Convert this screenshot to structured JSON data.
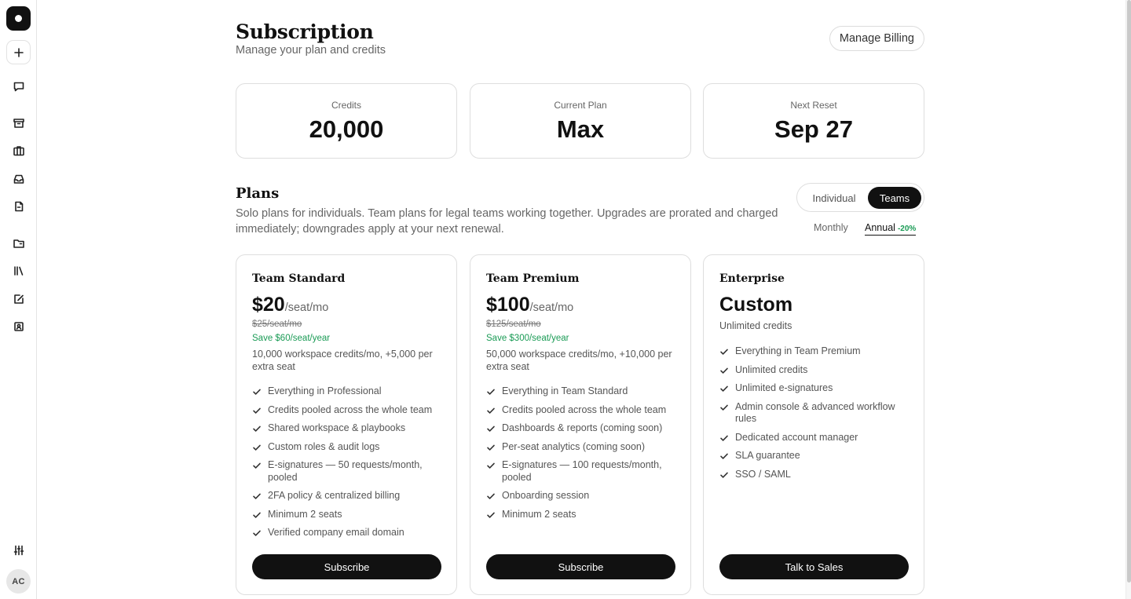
{
  "sidebar": {
    "avatar_initials": "AC",
    "icons": [
      "logo-icon",
      "plus-icon",
      "chat-icon",
      "archive-icon",
      "briefcase-icon",
      "inbox-icon",
      "documents-icon",
      "folder-icon",
      "library-icon",
      "edit-icon",
      "contact-icon",
      "settings-sliders-icon"
    ]
  },
  "header": {
    "title": "Subscription",
    "subtitle": "Manage your plan and credits",
    "manage_billing_label": "Manage Billing"
  },
  "stats": [
    {
      "label": "Credits",
      "value": "20,000"
    },
    {
      "label": "Current Plan",
      "value": "Max"
    },
    {
      "label": "Next Reset",
      "value": "Sep 27"
    }
  ],
  "plans": {
    "title": "Plans",
    "description": "Solo plans for individuals. Team plans for legal teams working together. Upgrades are prorated and charged immediately; downgrades apply at your next renewal.",
    "segment": {
      "individual_label": "Individual",
      "teams_label": "Teams",
      "selected": "Teams"
    },
    "billing": {
      "monthly_label": "Monthly",
      "annual_label": "Annual",
      "annual_discount": "-20%",
      "selected": "Annual"
    },
    "cards": [
      {
        "name": "Team Standard",
        "price": "$20",
        "per": "/seat/mo",
        "old_price": "$25/seat/mo",
        "save": "Save $60/seat/year",
        "credits": "10,000 workspace credits/mo, +5,000 per extra seat",
        "features": [
          "Everything in Professional",
          "Credits pooled across the whole team",
          "Shared workspace & playbooks",
          "Custom roles & audit logs",
          "E-signatures — 50 requests/month, pooled",
          "2FA policy & centralized billing",
          "Minimum 2 seats",
          "Verified company email domain"
        ],
        "cta": "Subscribe"
      },
      {
        "name": "Team Premium",
        "price": "$100",
        "per": "/seat/mo",
        "old_price": "$125/seat/mo",
        "save": "Save $300/seat/year",
        "credits": "50,000 workspace credits/mo, +10,000 per extra seat",
        "features": [
          "Everything in Team Standard",
          "Credits pooled across the whole team",
          "Dashboards & reports (coming soon)",
          "Per-seat analytics (coming soon)",
          "E-signatures — 100 requests/month, pooled",
          "Onboarding session",
          "Minimum 2 seats"
        ],
        "cta": "Subscribe"
      },
      {
        "name": "Enterprise",
        "price": "Custom",
        "subtitle": "Unlimited credits",
        "features": [
          "Everything in Team Premium",
          "Unlimited credits",
          "Unlimited e-signatures",
          "Admin console & advanced workflow rules",
          "Dedicated account manager",
          "SLA guarantee",
          "SSO / SAML"
        ],
        "cta": "Talk to Sales"
      }
    ]
  },
  "colors": {
    "accent": "#111111",
    "save_green": "#1a9b55",
    "border": "#dedede",
    "muted": "#666666"
  }
}
